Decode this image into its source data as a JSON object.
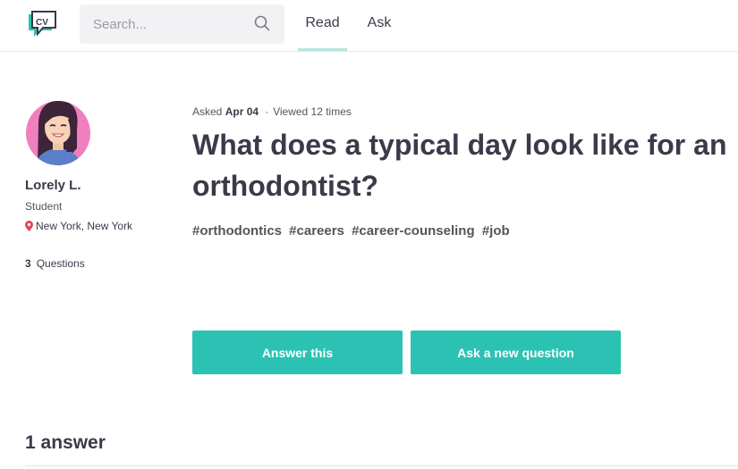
{
  "header": {
    "logo_text": "CV",
    "search_placeholder": "Search...",
    "nav": [
      {
        "label": "Read",
        "active": true
      },
      {
        "label": "Ask",
        "active": false
      }
    ]
  },
  "user": {
    "name": "Lorely L.",
    "role": "Student",
    "location": "New York, New York",
    "questions_count": "3",
    "questions_label": "Questions"
  },
  "question": {
    "asked_prefix": "Asked",
    "asked_date": "Apr 04",
    "viewed": "Viewed 12 times",
    "title": "What does a typical day look like for an orthodontist?",
    "tags": [
      "#orthodontics",
      "#careers",
      "#career-counseling",
      "#job"
    ]
  },
  "actions": {
    "answer_label": "Answer this",
    "ask_label": "Ask a new question"
  },
  "answers": {
    "heading": "1 answer"
  },
  "colors": {
    "accent": "#2cc2b3",
    "text": "#3b3a4a",
    "pin": "#e5485b",
    "avatar_bg": "#f07fbf"
  },
  "icons": [
    "cv-logo-icon",
    "search-icon",
    "location-pin-icon",
    "avatar"
  ]
}
